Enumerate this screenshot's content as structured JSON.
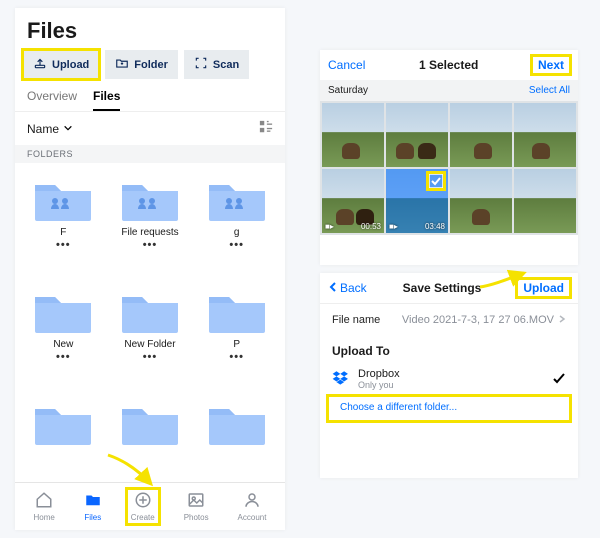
{
  "left": {
    "title": "Files",
    "actions": {
      "upload": "Upload",
      "folder": "Folder",
      "scan": "Scan"
    },
    "tabs": {
      "overview": "Overview",
      "files": "Files"
    },
    "sort_label": "Name",
    "section": "FOLDERS",
    "folders": [
      {
        "name": "F",
        "shared": true
      },
      {
        "name": "File requests",
        "shared": true
      },
      {
        "name": "g",
        "shared": true
      },
      {
        "name": "New",
        "shared": false
      },
      {
        "name": "New Folder",
        "shared": false
      },
      {
        "name": "P",
        "shared": false
      }
    ],
    "tabbar": {
      "home": "Home",
      "files": "Files",
      "create": "Create",
      "photos": "Photos",
      "account": "Account"
    }
  },
  "picker": {
    "cancel": "Cancel",
    "title": "1 Selected",
    "next": "Next",
    "day": "Saturday",
    "select_all": "Select All",
    "video_times": [
      "00:53",
      "03:48"
    ]
  },
  "save": {
    "back": "Back",
    "title": "Save Settings",
    "upload": "Upload",
    "filename_label": "File name",
    "filename_value": "Video 2021-7-3, 17 27 06.MOV",
    "upload_to": "Upload To",
    "dest_name": "Dropbox",
    "dest_sub": "Only you",
    "choose_diff": "Choose a different folder..."
  },
  "colors": {
    "folder": "#a5c8fb",
    "accent": "#006eff",
    "highlight": "#f5e200"
  }
}
